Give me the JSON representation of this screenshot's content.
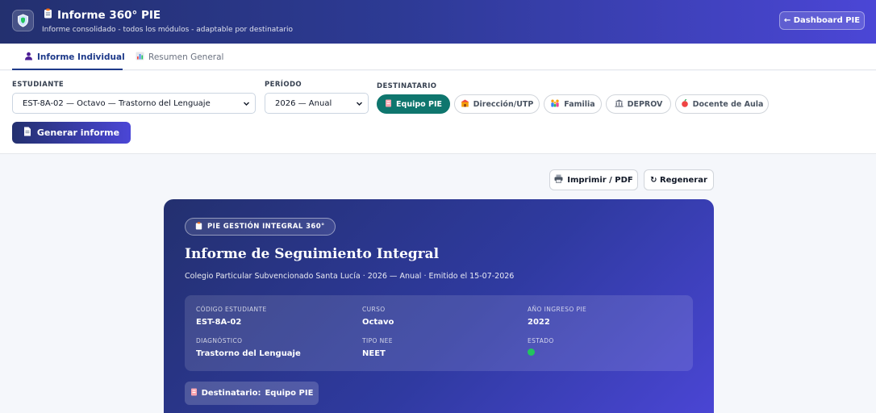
{
  "header": {
    "title": "Informe 360° PIE",
    "subtitle": "Informe consolidado - todos los módulos - adaptable por destinatario",
    "dashboard_button": "← Dashboard PIE"
  },
  "tabs": [
    {
      "label": "Informe Individual",
      "active": true
    },
    {
      "label": "Resumen General",
      "active": false
    }
  ],
  "filters": {
    "student_label": "ESTUDIANTE",
    "student_value": "EST-8A-02 — Octavo — Trastorno del Lenguaje",
    "period_label": "PERÍODO",
    "period_value": "2026 — Anual",
    "recipient_label": "DESTINATARIO",
    "recipients": [
      {
        "label": "Equipo PIE",
        "active": true
      },
      {
        "label": "Dirección/UTP",
        "active": false
      },
      {
        "label": "Familia",
        "active": false
      },
      {
        "label": "DEPROV",
        "active": false
      },
      {
        "label": "Docente de Aula",
        "active": false
      }
    ],
    "generate_button": "Generar informe"
  },
  "actions": {
    "print": "Imprimir / PDF",
    "regenerate": "↻ Regenerar"
  },
  "report": {
    "badge": "PIE GESTIÓN INTEGRAL 360°",
    "title": "Informe de Seguimiento Integral",
    "subtitle": "Colegio Particular Subvencionado Santa Lucía · 2026 — Anual · Emitido el 15-07-2026",
    "fields": {
      "code_label": "CÓDIGO ESTUDIANTE",
      "code_value": "EST-8A-02",
      "course_label": "CURSO",
      "course_value": "Octavo",
      "year_label": "AÑO INGRESO PIE",
      "year_value": "2022",
      "diag_label": "DIAGNÓSTICO",
      "diag_value": "Trastorno del Lenguaje",
      "nee_label": "TIPO NEE",
      "nee_value": "NEET",
      "status_label": "ESTADO",
      "status_color": "#22c55e"
    },
    "recipient_prefix": "Destinatario:",
    "recipient_value": "Equipo PIE"
  },
  "colors": {
    "brand_dark": "#23306f",
    "brand_light": "#4b46d6",
    "recipient_active": "#0f766e"
  }
}
